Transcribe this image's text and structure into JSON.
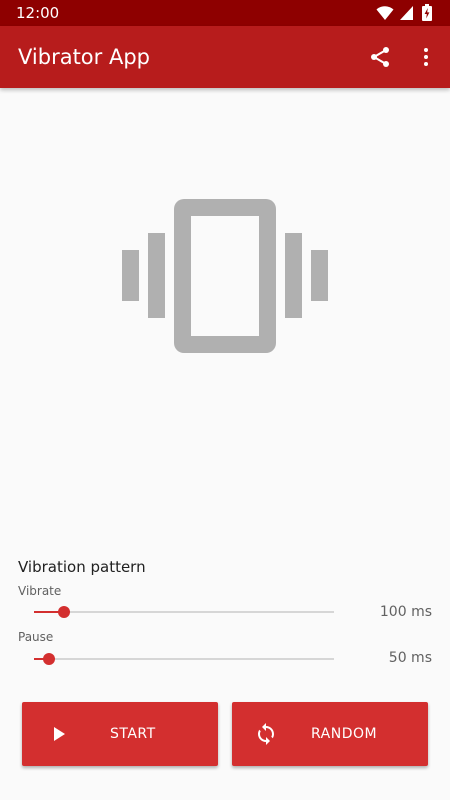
{
  "status_bar": {
    "time": "12:00",
    "icons": [
      "wifi-icon",
      "cellular-signal-icon",
      "battery-charging-icon"
    ]
  },
  "app_bar": {
    "title": "Vibrator App",
    "actions": [
      "share-icon",
      "more-vert-icon"
    ]
  },
  "illustration": {
    "icon": "vibration-icon",
    "color": "#b0b0b0"
  },
  "vibration_pattern": {
    "title": "Vibration pattern",
    "vibrate": {
      "label": "Vibrate",
      "value_text": "100 ms",
      "level": 0.1
    },
    "pause": {
      "label": "Pause",
      "value_text": "50 ms",
      "level": 0.05
    }
  },
  "buttons": {
    "start": {
      "label": "START",
      "icon": "play-icon"
    },
    "random": {
      "label": "RANDOM",
      "icon": "sync-icon"
    }
  },
  "colors": {
    "status_bar": "#8e0000",
    "app_bar": "#b71c1c",
    "accent": "#d32f2f",
    "background": "#fafafa"
  }
}
